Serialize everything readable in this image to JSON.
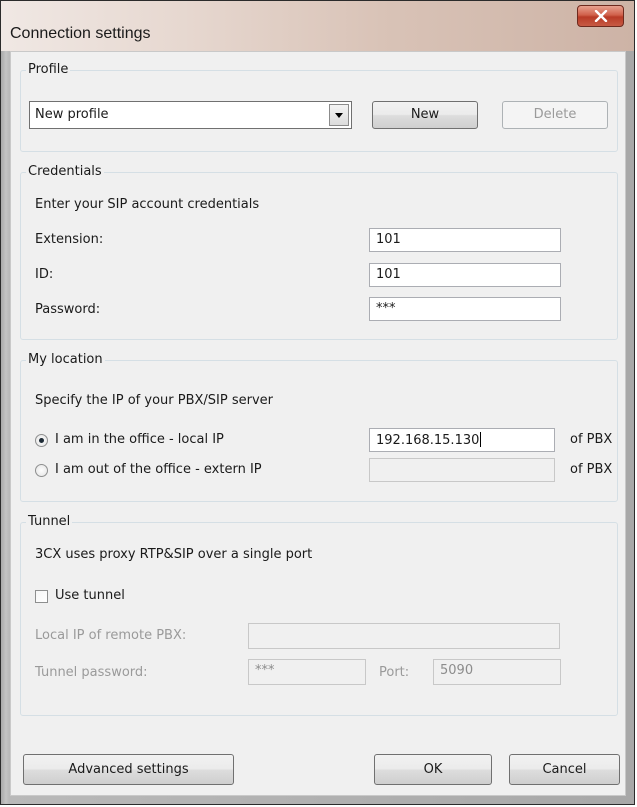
{
  "window": {
    "title": "Connection settings",
    "close_icon": "close-icon"
  },
  "profile": {
    "group_title": "Profile",
    "selected": "New profile",
    "new_label": "New",
    "delete_label": "Delete"
  },
  "credentials": {
    "group_title": "Credentials",
    "description": "Enter your SIP account credentials",
    "extension_label": "Extension:",
    "extension_value": "101",
    "id_label": "ID:",
    "id_value": "101",
    "password_label": "Password:",
    "password_value": "***"
  },
  "location": {
    "group_title": "My location",
    "description": "Specify the IP of your PBX/SIP server",
    "local_label": "I am in the office - local IP",
    "local_value": "192.168.15.130",
    "extern_label": "I am out of the office - extern IP",
    "extern_value": "",
    "of_pbx": "of PBX",
    "selected": "local"
  },
  "tunnel": {
    "group_title": "Tunnel",
    "description": "3CX uses proxy RTP&SIP over a single port",
    "use_tunnel_label": "Use tunnel",
    "use_tunnel_checked": false,
    "local_ip_label": "Local IP of remote PBX:",
    "local_ip_value": "",
    "password_label": "Tunnel password:",
    "password_value": "***",
    "port_label": "Port:",
    "port_value": "5090"
  },
  "footer": {
    "advanced_label": "Advanced settings",
    "ok_label": "OK",
    "cancel_label": "Cancel"
  }
}
